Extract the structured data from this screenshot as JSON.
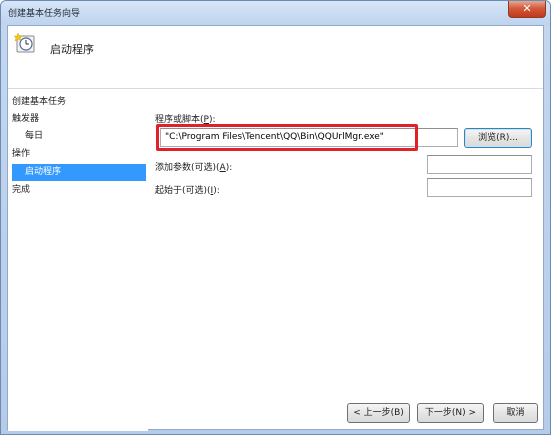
{
  "window": {
    "title": "创建基本任务向导",
    "close_glyph": "✕"
  },
  "header": {
    "title": "启动程序",
    "icon": "task-scheduler-clock-icon"
  },
  "nav": {
    "items": [
      {
        "label": "创建基本任务"
      },
      {
        "label": "触发器"
      },
      {
        "label": "每日"
      },
      {
        "label": "操作"
      },
      {
        "label": "启动程序"
      },
      {
        "label": "完成"
      }
    ]
  },
  "form": {
    "program_label_prefix": "程序或脚本(",
    "program_label_key": "P",
    "program_label_suffix": "):",
    "program_value": "\"C:\\Program Files\\Tencent\\QQ\\Bin\\QQUrlMgr.exe\"",
    "browse_label": "浏览(R)...",
    "args_label_prefix": "添加参数(可选)(",
    "args_label_key": "A",
    "args_label_suffix": "):",
    "args_value": "",
    "startin_label_prefix": "起始于(可选)(",
    "startin_label_key": "I",
    "startin_label_suffix": "):",
    "startin_value": ""
  },
  "footer": {
    "back_label": "< 上一步(B)",
    "next_label": "下一步(N) >",
    "cancel_label": "取消"
  },
  "colors": {
    "highlight": "#e0212a",
    "selection": "#3399ff"
  }
}
